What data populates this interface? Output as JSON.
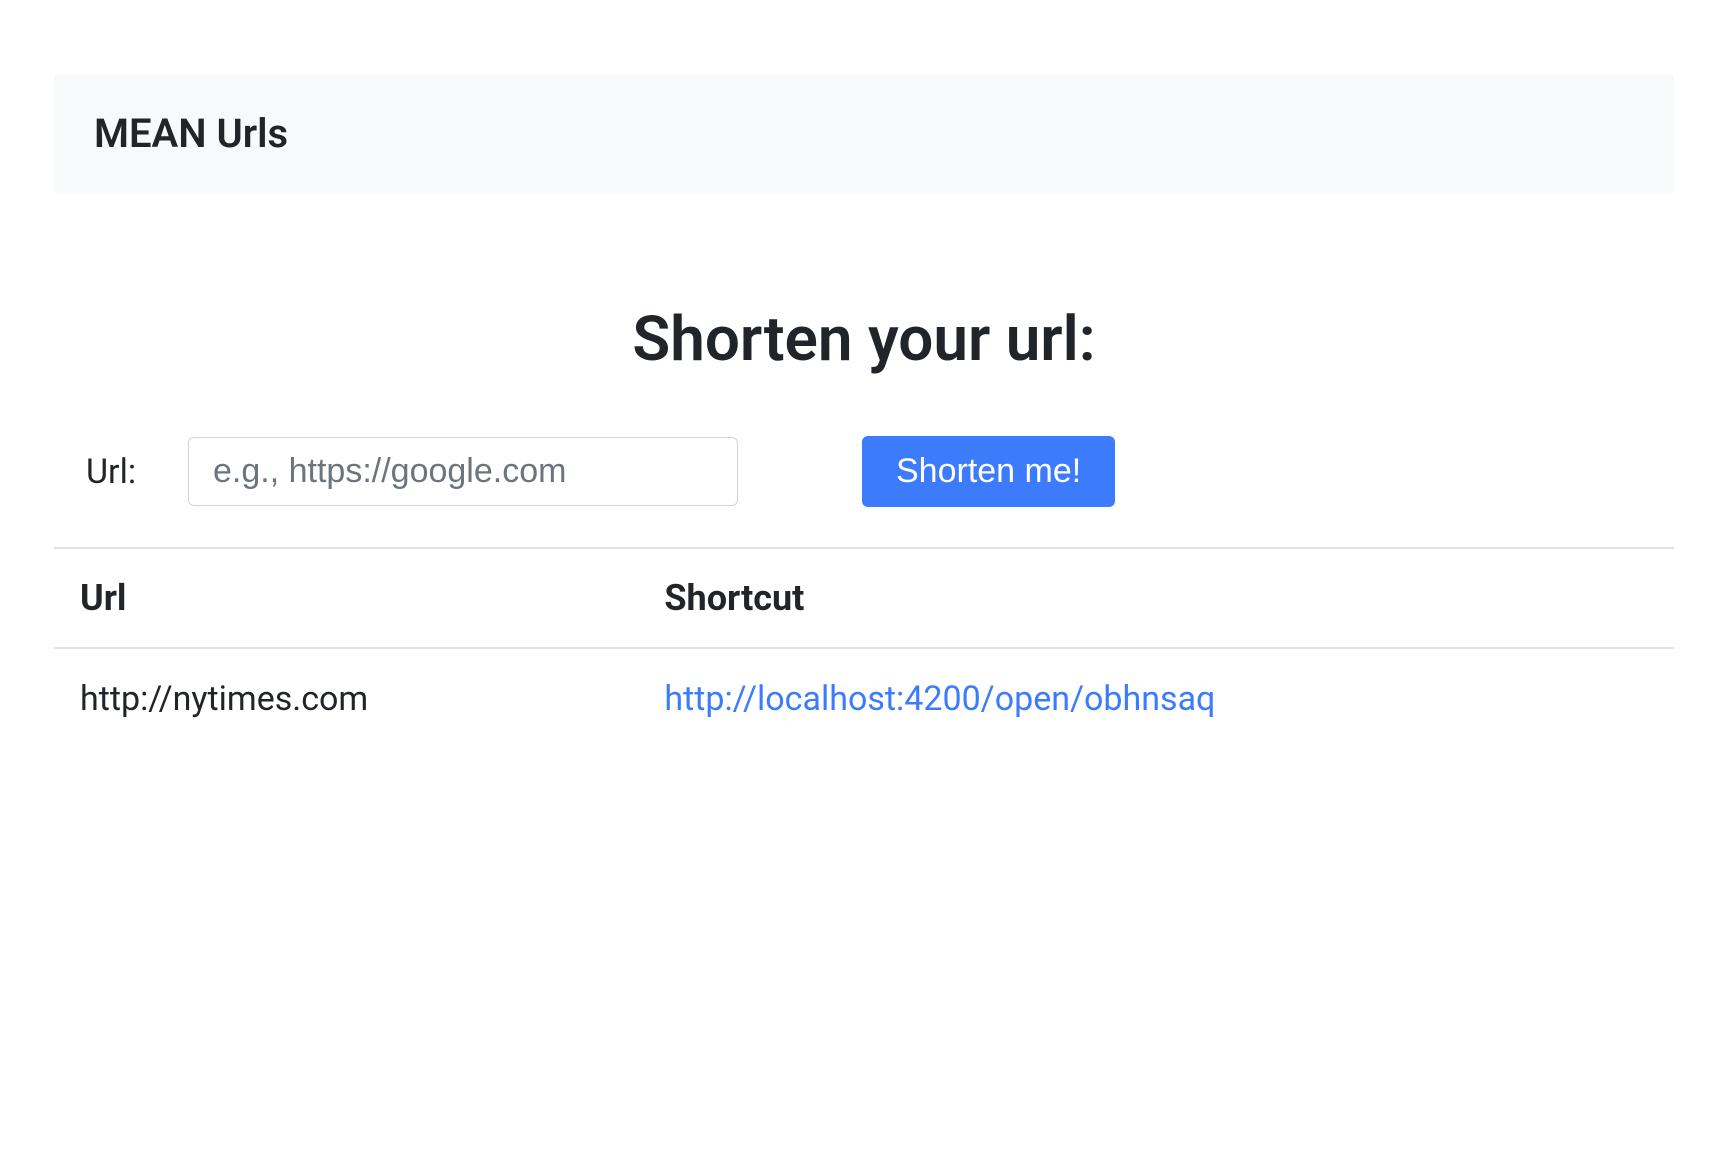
{
  "navbar": {
    "brand": "MEAN Urls"
  },
  "main": {
    "heading": "Shorten your url:",
    "form": {
      "url_label": "Url:",
      "url_placeholder": "e.g., https://google.com",
      "url_value": "",
      "submit_label": "Shorten me!"
    },
    "table": {
      "headers": {
        "url": "Url",
        "shortcut": "Shortcut"
      },
      "rows": [
        {
          "url": "http://nytimes.com",
          "shortcut": "http://localhost:4200/open/obhnsaq"
        }
      ]
    }
  }
}
